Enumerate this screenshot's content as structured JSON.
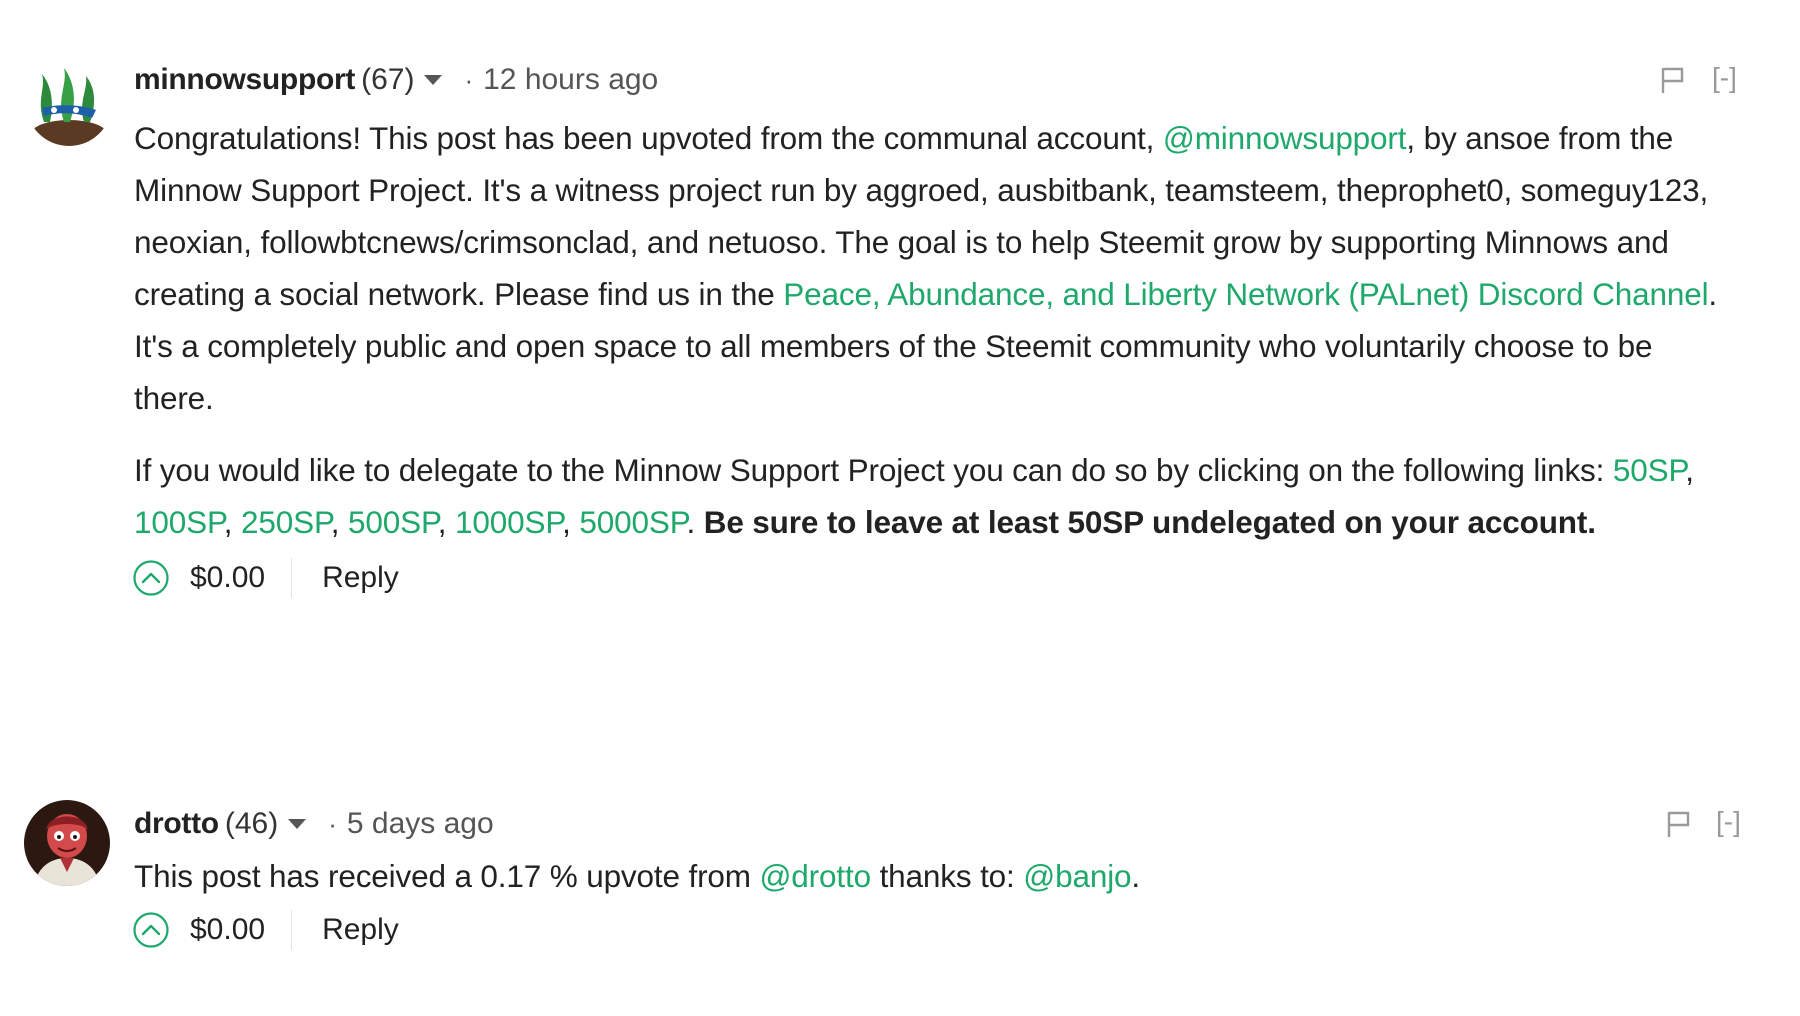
{
  "comments": [
    {
      "author": "minnowsupport",
      "reputation": "(67)",
      "separator": "·",
      "time": "12 hours ago",
      "collapse_label": "[-]",
      "body": {
        "p1_text1": "Congratulations! This post has been upvoted from the communal account, ",
        "p1_link1": "@minnowsupport",
        "p1_text2": ", by ansoe from the Minnow Support Project. It's a witness project run by aggroed, ausbitbank, teamsteem, theprophet0, someguy123, neoxian, followbtcnews/crimsonclad, and netuoso. The goal is to help Steemit grow by supporting Minnows and creating a social network. Please find us in the ",
        "p1_link2": "Peace, Abundance, and Liberty Network (PALnet) Discord Channel",
        "p1_text3": ". It's a completely public and open space to all members of the Steemit community who voluntarily choose to be there.",
        "p2_text1": "If you would like to delegate to the Minnow Support Project you can do so by clicking on the following links: ",
        "p2_links": [
          "50SP",
          "100SP",
          "250SP",
          "500SP",
          "1000SP",
          "5000SP"
        ],
        "p2_comma": ", ",
        "p2_period": ". ",
        "p2_bold": "Be sure to leave at least 50SP undelegated on your account."
      },
      "payout": "$0.00",
      "reply_label": "Reply"
    },
    {
      "author": "drotto",
      "reputation": "(46)",
      "separator": "·",
      "time": "5 days ago",
      "collapse_label": "[-]",
      "body": {
        "text1": "This post has received a 0.17 % upvote from ",
        "link1": "@drotto",
        "text2": " thanks to: ",
        "link2": "@banjo",
        "text3": "."
      },
      "payout": "$0.00",
      "reply_label": "Reply"
    }
  ],
  "colors": {
    "link": "#1fa86b",
    "upvote": "#1fa86b",
    "muted": "#9a9a9a"
  }
}
